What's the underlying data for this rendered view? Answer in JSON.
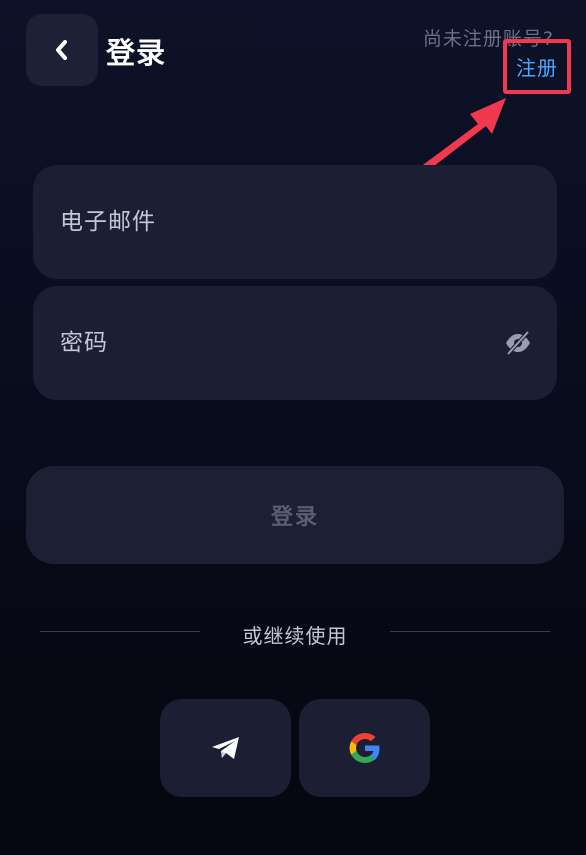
{
  "header": {
    "title": "登录",
    "back_icon": "chevron-left-icon",
    "signup_prompt": "尚未注册账号?",
    "signup_link": "注册"
  },
  "form": {
    "email_placeholder": "电子邮件",
    "password_placeholder": "密码",
    "password_toggle_icon": "eye-off-icon",
    "login_label": "登录"
  },
  "divider": {
    "text": "或继续使用"
  },
  "social": [
    {
      "name": "telegram",
      "icon": "telegram-icon"
    },
    {
      "name": "google",
      "icon": "google-icon"
    }
  ],
  "colors": {
    "background": "#0b0f22",
    "card": "#1c1f33",
    "link": "#4ea7ff",
    "highlight": "#f0394f",
    "disabled_text": "#5b5e70"
  }
}
